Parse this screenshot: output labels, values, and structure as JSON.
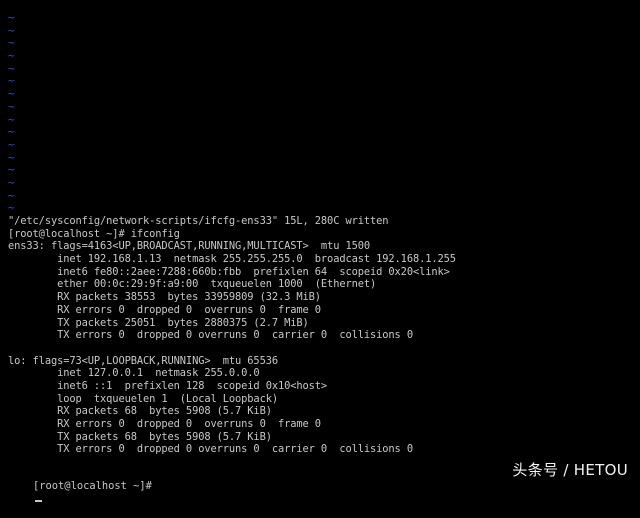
{
  "terminal": {
    "tildes": [
      "~",
      "~",
      "~",
      "~",
      "~",
      "~",
      "~",
      "~",
      "~",
      "~",
      "~",
      "~",
      "~",
      "~",
      "~",
      "~"
    ],
    "lines": [
      "\"/etc/sysconfig/network-scripts/ifcfg-ens33\" 15L, 280C written",
      "[root@localhost ~]# ifconfig",
      "ens33: flags=4163<UP,BROADCAST,RUNNING,MULTICAST>  mtu 1500",
      "        inet 192.168.1.13  netmask 255.255.255.0  broadcast 192.168.1.255",
      "        inet6 fe80::2aee:7288:660b:fbb  prefixlen 64  scopeid 0x20<link>",
      "        ether 00:0c:29:9f:a9:00  txqueuelen 1000  (Ethernet)",
      "        RX packets 38553  bytes 33959809 (32.3 MiB)",
      "        RX errors 0  dropped 0  overruns 0  frame 0",
      "        TX packets 25051  bytes 2880375 (2.7 MiB)",
      "        TX errors 0  dropped 0 overruns 0  carrier 0  collisions 0",
      "",
      "lo: flags=73<UP,LOOPBACK,RUNNING>  mtu 65536",
      "        inet 127.0.0.1  netmask 255.0.0.0",
      "        inet6 ::1  prefixlen 128  scopeid 0x10<host>",
      "        loop  txqueuelen 1  (Local Loopback)",
      "        RX packets 68  bytes 5908 (5.7 KiB)",
      "        RX errors 0  dropped 0  overruns 0  frame 0",
      "        TX packets 68  bytes 5908 (5.7 KiB)",
      "        TX errors 0  dropped 0 overruns 0  carrier 0  collisions 0"
    ],
    "prompt": "[root@localhost ~]#"
  },
  "watermark": "头条号 / HETOU",
  "colors": {
    "background": "#000000",
    "text": "#c8c8c8",
    "tilde": "#3a4fd6",
    "watermark": "#f2f2f2"
  }
}
